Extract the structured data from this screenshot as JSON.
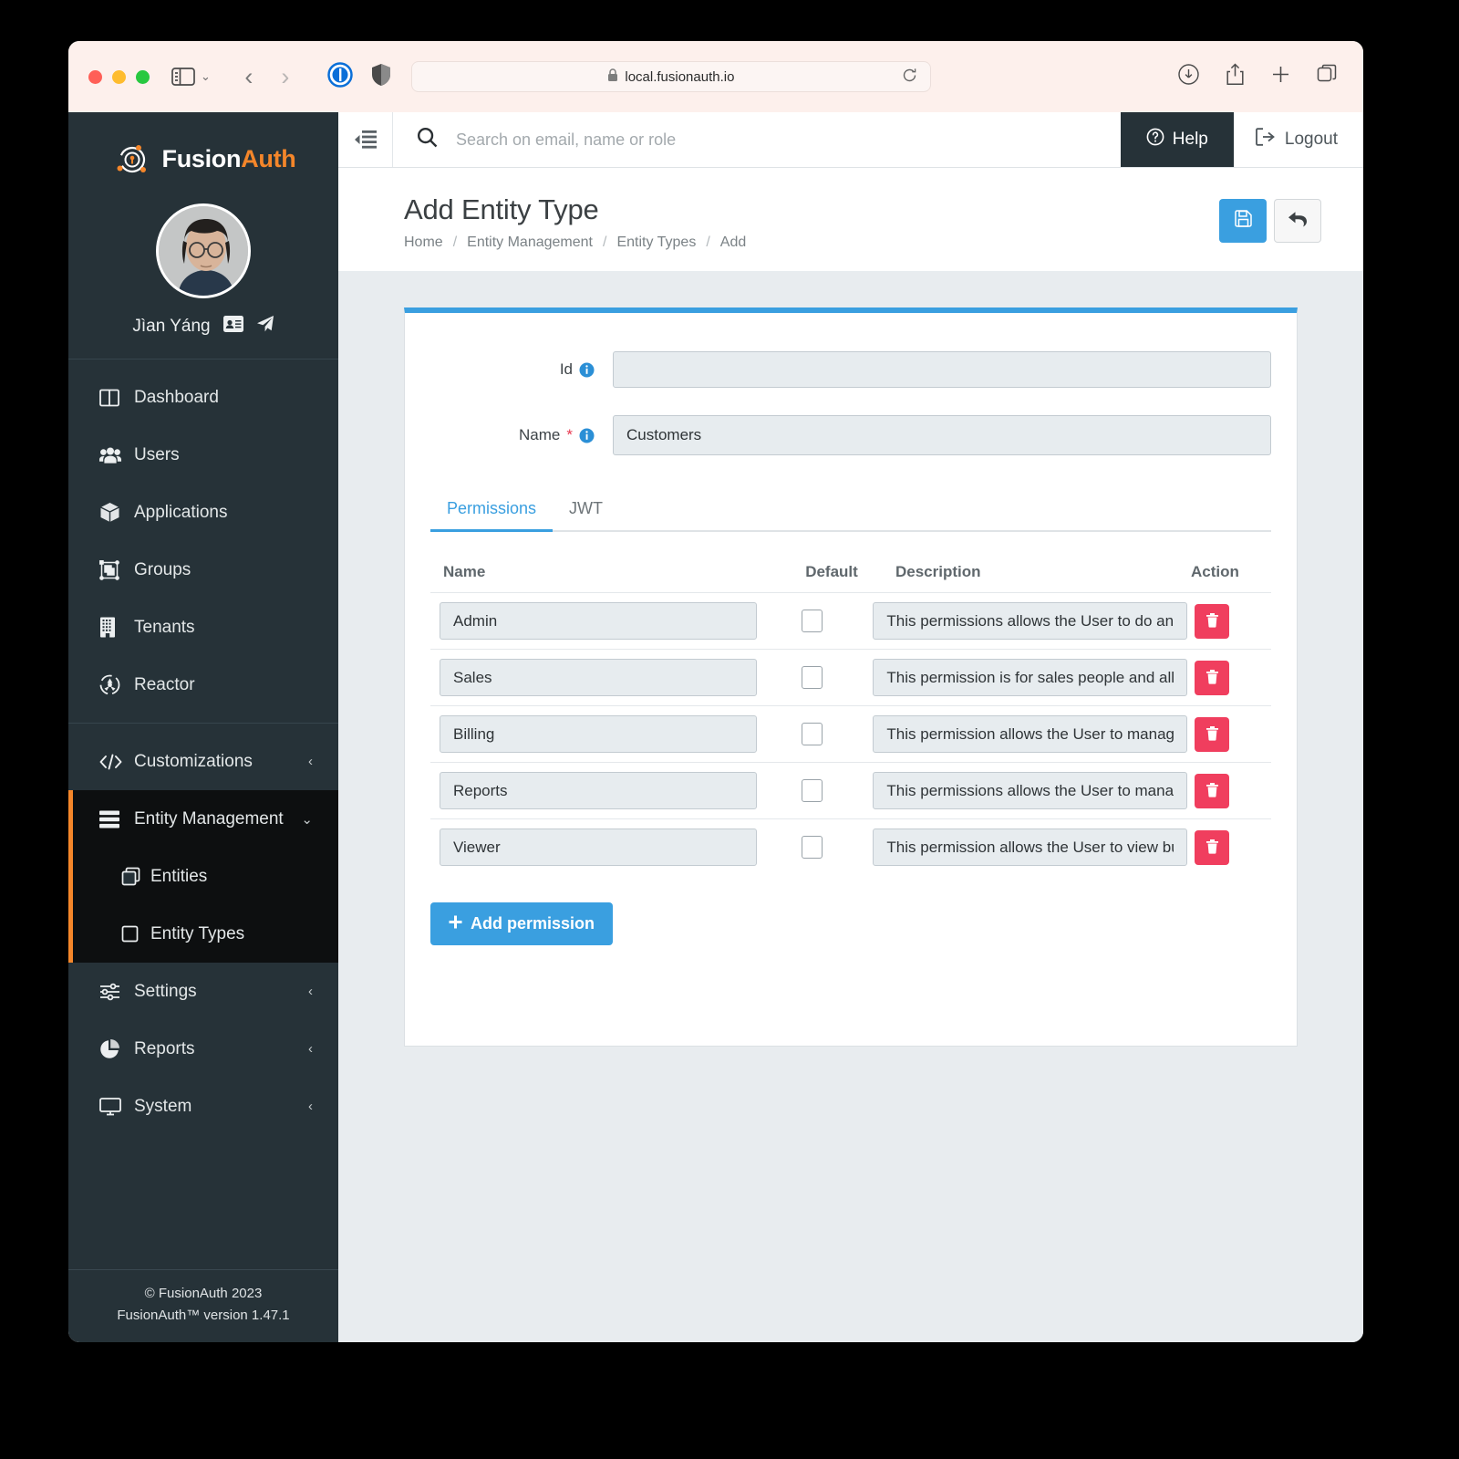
{
  "browser": {
    "url": "local.fusionauth.io",
    "lock_icon": "lock-icon",
    "reload_icon": "reload-icon",
    "back_icon": "back-arrow-icon",
    "forward_icon": "forward-arrow-icon",
    "sidebar_icon": "sidebar-toggle-icon",
    "download_icon": "download-icon",
    "share_icon": "share-icon",
    "new_tab_icon": "plus-icon",
    "tabs_icon": "tab-overview-icon",
    "extension_1password_icon": "1password-extension-icon",
    "extension_shield_icon": "privacy-shield-icon"
  },
  "sidebar": {
    "brand": {
      "first": "Fusion",
      "second": "Auth"
    },
    "user": {
      "name": "Jìan Yáng",
      "badge_icon": "id-card-icon",
      "impersonate_icon": "paper-plane-icon"
    },
    "items": [
      {
        "label": "Dashboard",
        "icon": "dashboard-icon"
      },
      {
        "label": "Users",
        "icon": "users-icon"
      },
      {
        "label": "Applications",
        "icon": "box-icon"
      },
      {
        "label": "Groups",
        "icon": "groups-icon"
      },
      {
        "label": "Tenants",
        "icon": "building-icon"
      },
      {
        "label": "Reactor",
        "icon": "reactor-icon"
      }
    ],
    "customizations": {
      "label": "Customizations",
      "icon": "code-icon",
      "caret": "‹"
    },
    "entity_management": {
      "label": "Entity Management",
      "icon": "server-icon",
      "caret": "⌄",
      "children": [
        {
          "label": "Entities",
          "icon": "copies-icon"
        },
        {
          "label": "Entity Types",
          "icon": "square-icon"
        }
      ]
    },
    "bottom_items": [
      {
        "label": "Settings",
        "icon": "sliders-icon",
        "caret": "‹"
      },
      {
        "label": "Reports",
        "icon": "pie-chart-icon",
        "caret": "‹"
      },
      {
        "label": "System",
        "icon": "monitor-icon",
        "caret": "‹"
      }
    ],
    "footer": {
      "copyright": "© FusionAuth 2023",
      "version": "FusionAuth™ version 1.47.1"
    }
  },
  "topbar": {
    "collapse_icon": "collapse-sidebar-icon",
    "search_icon": "search-icon",
    "search_placeholder": "Search on email, name or role",
    "search_value": "",
    "help_label": "Help",
    "help_icon": "question-circle-icon",
    "logout_label": "Logout",
    "logout_icon": "logout-icon"
  },
  "page": {
    "title": "Add Entity Type",
    "breadcrumb": [
      "Home",
      "Entity Management",
      "Entity Types",
      "Add"
    ],
    "breadcrumb_separator": "/",
    "actions": {
      "save_icon": "save-floppy-icon",
      "back_icon": "undo-arrow-icon"
    }
  },
  "form": {
    "id": {
      "label": "Id",
      "value": "",
      "placeholder": "",
      "info_icon": "info-circle-icon"
    },
    "name": {
      "label": "Name",
      "required_marker": "*",
      "value": "Customers",
      "info_icon": "info-circle-icon"
    }
  },
  "tabs": [
    {
      "label": "Permissions",
      "active": true
    },
    {
      "label": "JWT",
      "active": false
    }
  ],
  "permissions_table": {
    "columns": [
      "Name",
      "Default",
      "Description",
      "Action"
    ],
    "rows": [
      {
        "name": "Admin",
        "default": false,
        "description": "This permissions allows the User to do any",
        "delete_icon": "trash-icon"
      },
      {
        "name": "Sales",
        "default": false,
        "description": "This permission is for sales people and all",
        "delete_icon": "trash-icon"
      },
      {
        "name": "Billing",
        "default": false,
        "description": "This permission allows the User to manage",
        "delete_icon": "trash-icon"
      },
      {
        "name": "Reports",
        "default": false,
        "description": "This permissions allows the User to manag",
        "delete_icon": "trash-icon"
      },
      {
        "name": "Viewer",
        "default": false,
        "description": "This permission allows the User to view bu",
        "delete_icon": "trash-icon"
      }
    ],
    "add_button": {
      "label": "Add permission",
      "icon": "plus-icon"
    }
  },
  "colors": {
    "accent_blue": "#3a9fe0",
    "brand_orange": "#f4862a",
    "sidebar_bg": "#263238",
    "page_bg": "#e8ecef",
    "danger_red": "#f03e5e",
    "required_red": "#e8384f"
  }
}
